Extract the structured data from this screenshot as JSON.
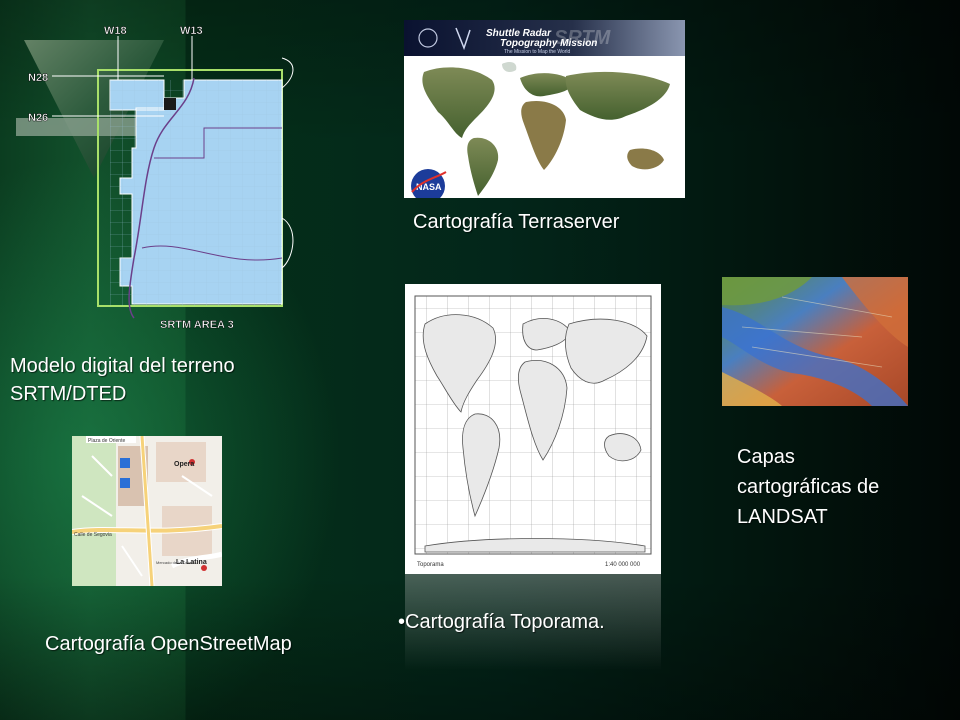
{
  "srtm": {
    "labels": {
      "w18": "W18",
      "w13": "W13",
      "n28": "N28",
      "n26": "N26",
      "area": "SRTM AREA 3"
    }
  },
  "terraserver": {
    "banner_title_1": "Shuttle Radar",
    "banner_title_2": "Topography Mission",
    "banner_tagline": "The Mission to Map the World",
    "banner_big": "SRTM",
    "nasa": "NASA"
  },
  "osm": {
    "labels": {
      "top_street": "Plaza de Oriente",
      "opera": "Opera",
      "calle": "Calle de Segovia",
      "latina": "La Latina",
      "market": "Mercado de la Cebada"
    }
  },
  "toporama": {
    "footer_left": "Toporama",
    "footer_right": "1:40 000 000"
  },
  "captions": {
    "srtm_line1": "Modelo digital del terreno",
    "srtm_line2": "SRTM/DTED",
    "terraserver": "Cartografía Terraserver",
    "landsat_line1": "Capas",
    "landsat_line2": "cartográficas de",
    "landsat_line3": "LANDSAT",
    "toporama": "•Cartografía Toporama.",
    "osm": "Cartografía OpenStreetMap"
  }
}
